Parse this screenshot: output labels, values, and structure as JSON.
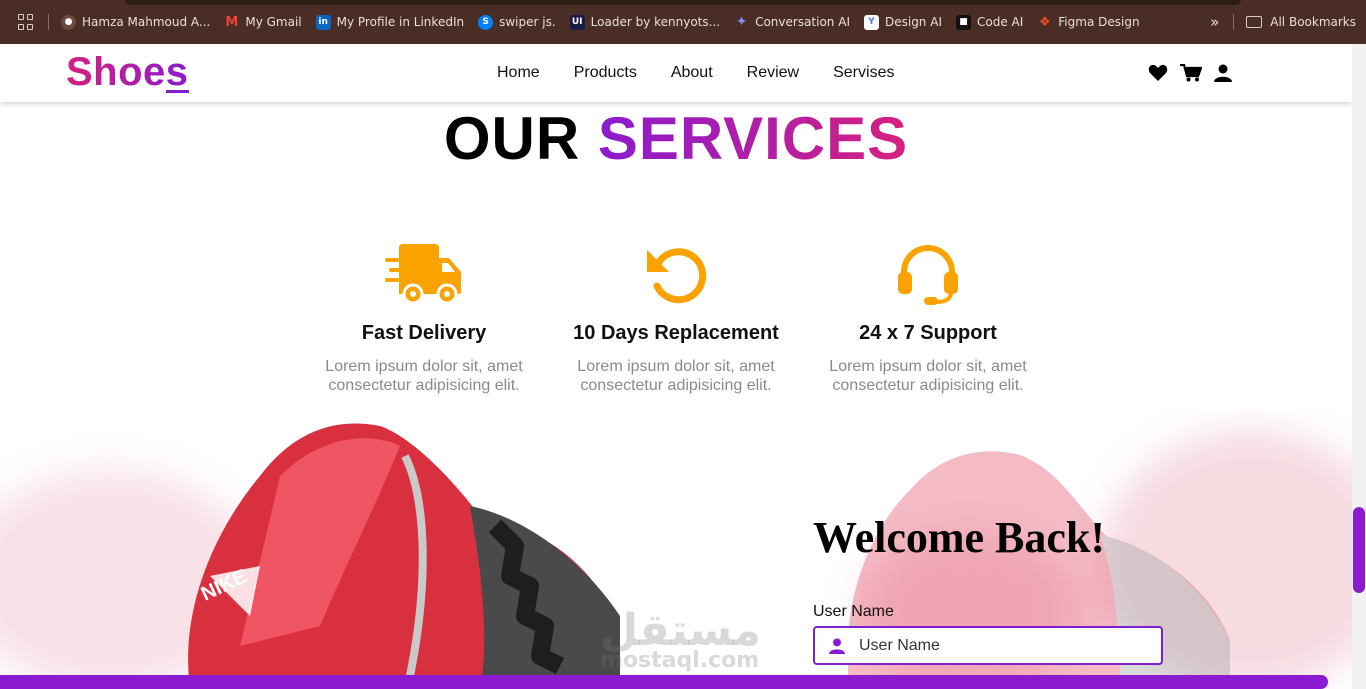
{
  "bookmarks": {
    "items": [
      {
        "label": "Hamza Mahmoud A...",
        "color": "#6b4a3f"
      },
      {
        "label": "My Gmail",
        "color": "#ea4335"
      },
      {
        "label": "My Profile in LinkedIn",
        "color": "#0a66c2"
      },
      {
        "label": "swiper js.",
        "color": "#0080ff"
      },
      {
        "label": "Loader by kennyots...",
        "color": "#1a1a4a"
      },
      {
        "label": "Conversation AI",
        "color": "#5a6fd6"
      },
      {
        "label": "Design AI",
        "color": "#4a7bd8"
      },
      {
        "label": "Code AI",
        "color": "#222222"
      },
      {
        "label": "Figma Design",
        "color": "#f24e1e"
      }
    ],
    "all_label": "All Bookmarks"
  },
  "header": {
    "logo": "Shoes",
    "nav": [
      "Home",
      "Products",
      "About",
      "Review",
      "Servises"
    ],
    "icons": [
      "heart-icon",
      "cart-icon",
      "user-icon"
    ]
  },
  "services": {
    "title_part1": "OUR",
    "title_part2": "SERVICES",
    "accent": "#f9a200",
    "items": [
      {
        "icon": "truck-icon",
        "title": "Fast Delivery",
        "text": "Lorem ipsum dolor sit, amet consectetur adipisicing elit."
      },
      {
        "icon": "replace-icon",
        "title": "10 Days Replacement",
        "text": "Lorem ipsum dolor sit, amet consectetur adipisicing elit."
      },
      {
        "icon": "headset-icon",
        "title": "24 x 7 Support",
        "text": "Lorem ipsum dolor sit, amet consectetur adipisicing elit."
      }
    ]
  },
  "login": {
    "title": "Welcome Back!",
    "username_label": "User Name",
    "username_placeholder": "User Name"
  },
  "watermark": {
    "arabic": "مستقل",
    "latin": "mostaql.com"
  },
  "colors": {
    "brand_pink": "#d6217e",
    "brand_purple": "#8a1bd0",
    "bookmark_bar": "#4a2e25"
  }
}
